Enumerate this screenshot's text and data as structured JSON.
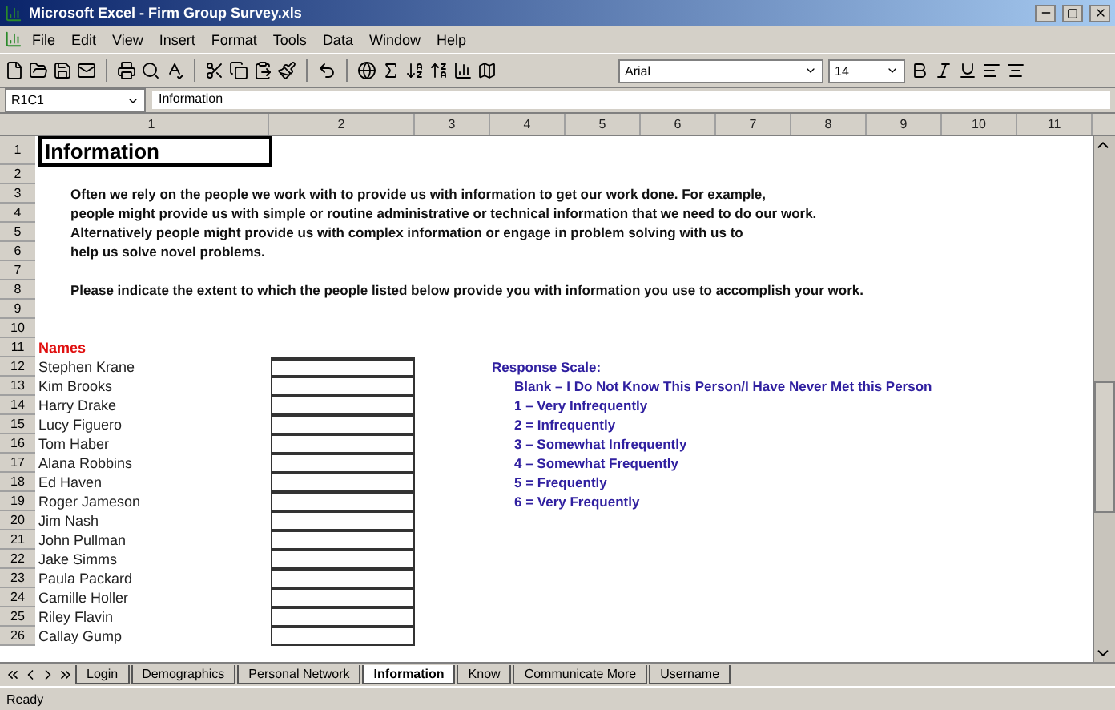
{
  "window": {
    "title": "Microsoft Excel - Firm Group Survey.xls"
  },
  "menu": [
    "File",
    "Edit",
    "View",
    "Insert",
    "Format",
    "Tools",
    "Data",
    "Window",
    "Help"
  ],
  "toolbar": {
    "font": "Arial",
    "size": "14"
  },
  "formula_bar": {
    "name_box": "R1C1",
    "value": "Information"
  },
  "columns": [
    "1",
    "2",
    "3",
    "4",
    "5",
    "6",
    "7",
    "8",
    "9",
    "10",
    "11"
  ],
  "row_numbers": [
    "1",
    "2",
    "3",
    "4",
    "5",
    "6",
    "7",
    "8",
    "9",
    "10",
    "11",
    "12",
    "13",
    "14",
    "15",
    "16",
    "17",
    "18",
    "19",
    "20",
    "21",
    "22",
    "23",
    "24",
    "25",
    "26"
  ],
  "sheet": {
    "heading": "Information",
    "intro": [
      "Often we rely on the people we work with to provide us with information to get our work done.  For example,",
      "people might provide us with simple or routine administrative or technical information that we need to do our work.",
      "Alternatively people might provide us with complex information or engage in problem solving with us to",
      "help us solve novel problems."
    ],
    "instruction": "Please indicate the extent to which the people listed below provide you with information you use to accomplish your work.",
    "names_header": "Names",
    "people": [
      "Stephen Krane",
      "Kim Brooks",
      "Harry Drake",
      "Lucy Figuero",
      "Tom Haber",
      "Alana Robbins",
      "Ed Haven",
      "Roger Jameson",
      "Jim Nash",
      "John Pullman",
      "Jake Simms",
      "Paula Packard",
      "Camille Holler",
      "Riley Flavin",
      "Callay Gump"
    ],
    "scale_title": "Response Scale:",
    "scale": [
      "Blank – I Do Not Know This Person/I Have Never Met this Person",
      "1 – Very Infrequently",
      "2 = Infrequently",
      "3 – Somewhat Infrequently",
      "4 – Somewhat Frequently",
      "5 = Frequently",
      "6 = Very Frequently"
    ]
  },
  "sheet_tabs": [
    {
      "label": "Login",
      "selected": false
    },
    {
      "label": "Demographics",
      "selected": false
    },
    {
      "label": "Personal Network",
      "selected": false
    },
    {
      "label": "Information",
      "selected": true
    },
    {
      "label": "Know",
      "selected": false
    },
    {
      "label": "Communicate More",
      "selected": false
    },
    {
      "label": "Username",
      "selected": false
    }
  ],
  "status_bar": "Ready"
}
